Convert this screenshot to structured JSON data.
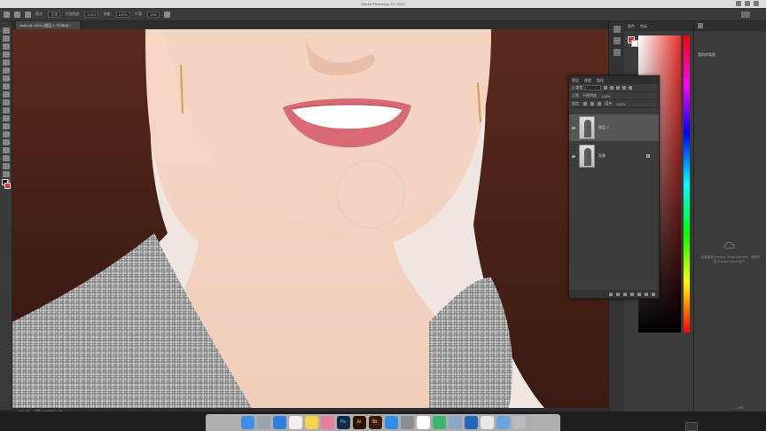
{
  "menubar": {
    "title": "Adobe Photoshop CC 2019"
  },
  "options_bar": {
    "labels": [
      "模式:",
      "正常",
      "不透明度:",
      "100%",
      "流量:",
      "100%",
      "平滑:",
      "10%"
    ]
  },
  "document_tab": {
    "title": "ceshi @ 100% (图层 1, RGB/8) *"
  },
  "status_bar": {
    "zoom": "100.4%",
    "info": "文档:26.6M/53.2M"
  },
  "color_panel": {
    "tabs": [
      "颜色",
      "色板"
    ],
    "foreground": "#e8302a",
    "background": "#ffffff"
  },
  "layers_panel": {
    "tabs": [
      "图层",
      "通道",
      "路径"
    ],
    "kind_label": "Q 类型",
    "blend_mode": "正常",
    "opacity_label": "不透明度:",
    "opacity": "100%",
    "lock_label": "锁定:",
    "fill_label": "填充:",
    "fill": "100%",
    "layers": [
      {
        "name": "图层 1",
        "active": true
      },
      {
        "name": "背景",
        "active": false
      }
    ]
  },
  "libraries_panel": {
    "title": "我的库管理",
    "message": "若要使用 Creative Cloud Libraries，请登录到 Creative Cloud 帐户。",
    "footer": "-- KB"
  },
  "dock": {
    "apps": [
      {
        "name": "Finder",
        "color": "#3d8fe8",
        "label": ""
      },
      {
        "name": "Launchpad",
        "color": "#9aa3ad",
        "label": ""
      },
      {
        "name": "Safari",
        "color": "#2f7ee0",
        "label": ""
      },
      {
        "name": "Calendar",
        "color": "#f0f0f0",
        "label": ""
      },
      {
        "name": "Notes",
        "color": "#f3d24e",
        "label": ""
      },
      {
        "name": "Photos",
        "color": "#e67f9c",
        "label": ""
      },
      {
        "name": "Photoshop",
        "color": "#0f2a44",
        "label": "Ps"
      },
      {
        "name": "Illustrator",
        "color": "#2a1300",
        "label": "Ai"
      },
      {
        "name": "Bridge",
        "color": "#3a1d10",
        "label": "Br"
      },
      {
        "name": "AppStore",
        "color": "#2f8ce8",
        "label": ""
      },
      {
        "name": "Preferences",
        "color": "#8a8d92",
        "label": ""
      },
      {
        "name": "QQ",
        "color": "#ffffff",
        "label": ""
      },
      {
        "name": "WeChat",
        "color": "#3cb371",
        "label": ""
      },
      {
        "name": "Preview",
        "color": "#8aa6c8",
        "label": ""
      },
      {
        "name": "Browser",
        "color": "#2466b8",
        "label": ""
      },
      {
        "name": "Doc",
        "color": "#e8e8e8",
        "label": ""
      },
      {
        "name": "Folder",
        "color": "#6aa6de",
        "label": ""
      },
      {
        "name": "Trash",
        "color": "#b9bcc0",
        "label": ""
      }
    ]
  }
}
